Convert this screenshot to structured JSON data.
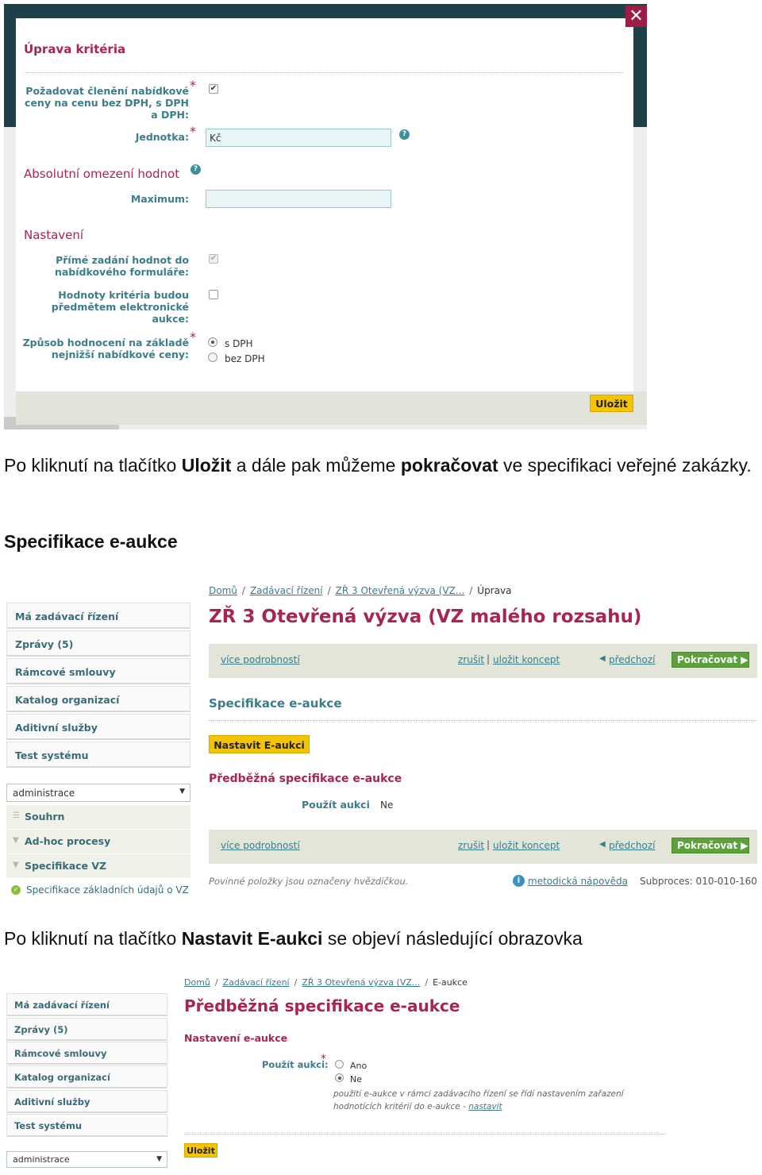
{
  "modal": {
    "title": "Úprava kritéria",
    "close_glyph": "✕",
    "field_split": {
      "label": "Požadovat členění nabídkové ceny na cenu bez DPH, s DPH a DPH:",
      "checked": true
    },
    "field_unit": {
      "label": "Jednotka:",
      "value": "Kč"
    },
    "section_abs": "Absolutní omezení hodnot",
    "field_max": {
      "label": "Maximum:",
      "value": ""
    },
    "section_settings": "Nastavení",
    "field_direct": {
      "label": "Přímé zadání hodnot do nabídkového formuláře:",
      "checked": true
    },
    "field_auction": {
      "label": "Hodnoty kritéria budou předmětem elektronické aukce:",
      "checked": false
    },
    "field_eval": {
      "label": "Způsob hodnocení na základě nejnižší nabídkové ceny:",
      "options": [
        "s DPH",
        "bez DPH"
      ],
      "selected": "s DPH"
    },
    "save_label": "Uložit"
  },
  "text1": {
    "a": "Po kliknutí na tlačítko ",
    "b": "Uložit",
    "c": " a dále pak můžeme ",
    "d": "pokračovat",
    "e": " ve specifikaci veřejné zakázky."
  },
  "heading1": "Specifikace e-aukce",
  "sidebar": {
    "items": [
      "Má zadávací řízení",
      "Zprávy (5)",
      "Rámcové smlouvy",
      "Katalog organizací",
      "Aditivní služby",
      "Test systému"
    ],
    "select": "administrace",
    "subnav": [
      "Souhrn",
      "Ad-hoc procesy",
      "Specifikace VZ",
      "Specifikace základních údajů o VZ"
    ]
  },
  "screen2": {
    "breadcrumb": [
      "Domů",
      "Zadávací řízení",
      "ZŘ 3 Otevřená výzva (VZ...",
      "Úprava"
    ],
    "title": "ZŘ 3 Otevřená výzva (VZ malého rozsahu)",
    "toolbar": {
      "more": "více podrobností",
      "cancel": "zrušit",
      "save_draft": "uložit koncept",
      "prev": "předchozí",
      "next": "Pokračovat"
    },
    "section": "Specifikace e-aukce",
    "set_button": "Nastavit E-aukci",
    "subsection": "Předběžná specifikace e-aukce",
    "use_label": "Použít aukci",
    "use_value": "Ne",
    "required_note": "Povinné položky jsou označeny hvězdičkou.",
    "help_link": "metodická nápověda",
    "subprocess": "Subproces: 010-010-160"
  },
  "text2": {
    "a": "Po kliknutí na tlačítko ",
    "b": "Nastavit E-aukci",
    "c": " se objeví následující obrazovka"
  },
  "screen3": {
    "breadcrumb": [
      "Domů",
      "Zadávací řízení",
      "ZŘ 3 Otevřená výzva (VZ...",
      "E-aukce"
    ],
    "title": "Předběžná specifikace e-aukce",
    "section": "Nastavení e-aukce",
    "use_label": "Použít aukci:",
    "options": [
      "Ano",
      "Ne"
    ],
    "selected": "Ne",
    "hint_text": "použití e-aukce v rámci zadávacího řízení se řídí nastavením zařazení hodnotících kritérií do e-aukce - ",
    "hint_link": "nastavit",
    "save_label": "Uložit"
  }
}
